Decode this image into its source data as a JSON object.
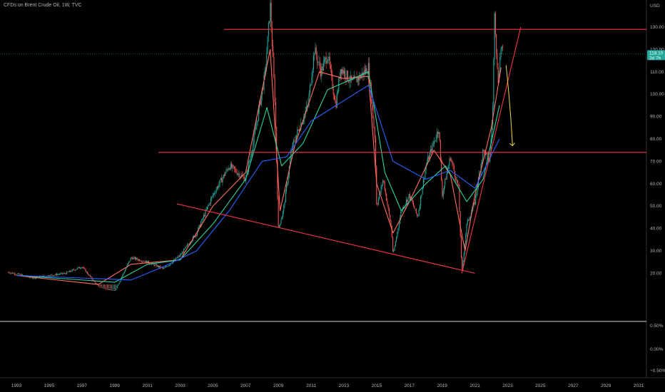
{
  "header": {
    "title": "CFDs on Brent Crude Oil, 1W, TVC",
    "currency": "USD"
  },
  "price_tag": {
    "value": "118.10",
    "countdown": "3d 7h",
    "color": "#26a69a"
  },
  "colors": {
    "background": "#000000",
    "resistance_lines": "#f23645",
    "arrow": "#f5d547",
    "ma_fast": "#ff6f61",
    "ma_mid": "#2bd4a4",
    "ma_slow": "#2962ff",
    "candle_up": "#26a69a",
    "candle_down": "#ef5350"
  },
  "chart_data": {
    "type": "candlestick",
    "symbol": "CFDs on Brent Crude Oil, 1W, TVC",
    "currency": "USD",
    "ylim": [
      20,
      145
    ],
    "y_ticks": [
      "130.00",
      "120.00",
      "110.00",
      "100.00",
      "90.00",
      "80.00",
      "70.00",
      "60.00",
      "50.00",
      "40.00",
      "30.00",
      "20.00"
    ],
    "x_ticks": [
      "1993",
      "1995",
      "1997",
      "1999",
      "2001",
      "2003",
      "2005",
      "2007",
      "2009",
      "2011",
      "2013",
      "2015",
      "2017",
      "2019",
      "2021",
      "2023",
      "2025",
      "2027",
      "2029",
      "2031"
    ],
    "indicator_ticks": [
      "0.50%",
      "0.00%",
      "−0.50%"
    ],
    "last_price": 118.1,
    "price_path": [
      {
        "x": 1992.5,
        "y": 20.5
      },
      {
        "x": 1994,
        "y": 18
      },
      {
        "x": 1996,
        "y": 20
      },
      {
        "x": 1997,
        "y": 23
      },
      {
        "x": 1998,
        "y": 14
      },
      {
        "x": 1999,
        "y": 12
      },
      {
        "x": 2000,
        "y": 27
      },
      {
        "x": 2001,
        "y": 25
      },
      {
        "x": 2002,
        "y": 22
      },
      {
        "x": 2003,
        "y": 28
      },
      {
        "x": 2004,
        "y": 38
      },
      {
        "x": 2005,
        "y": 55
      },
      {
        "x": 2006,
        "y": 68
      },
      {
        "x": 2007,
        "y": 62
      },
      {
        "x": 2007.5,
        "y": 80
      },
      {
        "x": 2008.2,
        "y": 110
      },
      {
        "x": 2008.5,
        "y": 140
      },
      {
        "x": 2008.8,
        "y": 95
      },
      {
        "x": 2009,
        "y": 40
      },
      {
        "x": 2009.3,
        "y": 48
      },
      {
        "x": 2009.8,
        "y": 75
      },
      {
        "x": 2010,
        "y": 80
      },
      {
        "x": 2010.8,
        "y": 95
      },
      {
        "x": 2011.2,
        "y": 120
      },
      {
        "x": 2011.6,
        "y": 110
      },
      {
        "x": 2012,
        "y": 118
      },
      {
        "x": 2012.5,
        "y": 95
      },
      {
        "x": 2012.8,
        "y": 112
      },
      {
        "x": 2013.5,
        "y": 105
      },
      {
        "x": 2014,
        "y": 108
      },
      {
        "x": 2014.5,
        "y": 112
      },
      {
        "x": 2014.9,
        "y": 80
      },
      {
        "x": 2015,
        "y": 50
      },
      {
        "x": 2015.4,
        "y": 62
      },
      {
        "x": 2015.9,
        "y": 40
      },
      {
        "x": 2016,
        "y": 28
      },
      {
        "x": 2016.5,
        "y": 48
      },
      {
        "x": 2017,
        "y": 55
      },
      {
        "x": 2017.5,
        "y": 45
      },
      {
        "x": 2018,
        "y": 68
      },
      {
        "x": 2018.8,
        "y": 85
      },
      {
        "x": 2019,
        "y": 55
      },
      {
        "x": 2019.5,
        "y": 72
      },
      {
        "x": 2020,
        "y": 58
      },
      {
        "x": 2020.2,
        "y": 20
      },
      {
        "x": 2020.5,
        "y": 42
      },
      {
        "x": 2021,
        "y": 52
      },
      {
        "x": 2021.5,
        "y": 75
      },
      {
        "x": 2021.9,
        "y": 70
      },
      {
        "x": 2022.1,
        "y": 95
      },
      {
        "x": 2022.2,
        "y": 139
      },
      {
        "x": 2022.4,
        "y": 105
      },
      {
        "x": 2022.6,
        "y": 122
      },
      {
        "x": 2022.7,
        "y": 118.1
      }
    ],
    "moving_averages": [
      {
        "name": "",
        "color": "#ff6f61",
        "y": [
          {
            "x": 1993,
            "y": 19
          },
          {
            "x": 1998,
            "y": 15
          },
          {
            "x": 2000,
            "y": 24
          },
          {
            "x": 2003,
            "y": 26
          },
          {
            "x": 2005,
            "y": 50
          },
          {
            "x": 2007,
            "y": 65
          },
          {
            "x": 2008.5,
            "y": 120
          },
          {
            "x": 2009.1,
            "y": 48
          },
          {
            "x": 2010,
            "y": 77
          },
          {
            "x": 2011.5,
            "y": 110
          },
          {
            "x": 2013,
            "y": 107
          },
          {
            "x": 2014.5,
            "y": 108
          },
          {
            "x": 2015,
            "y": 60
          },
          {
            "x": 2016,
            "y": 38
          },
          {
            "x": 2017,
            "y": 52
          },
          {
            "x": 2018.5,
            "y": 75
          },
          {
            "x": 2019.5,
            "y": 64
          },
          {
            "x": 2020.4,
            "y": 30
          },
          {
            "x": 2021,
            "y": 55
          },
          {
            "x": 2022,
            "y": 85
          },
          {
            "x": 2022.6,
            "y": 112
          }
        ]
      },
      {
        "name": "",
        "color": "#2bd4a4",
        "y": [
          {
            "x": 1993,
            "y": 19
          },
          {
            "x": 1999,
            "y": 16
          },
          {
            "x": 2001,
            "y": 24
          },
          {
            "x": 2003,
            "y": 26
          },
          {
            "x": 2005,
            "y": 42
          },
          {
            "x": 2007,
            "y": 62
          },
          {
            "x": 2008.3,
            "y": 94
          },
          {
            "x": 2009.2,
            "y": 68
          },
          {
            "x": 2010.5,
            "y": 78
          },
          {
            "x": 2012,
            "y": 102
          },
          {
            "x": 2014.5,
            "y": 110
          },
          {
            "x": 2015.5,
            "y": 65
          },
          {
            "x": 2016.5,
            "y": 48
          },
          {
            "x": 2018,
            "y": 60
          },
          {
            "x": 2019.2,
            "y": 68
          },
          {
            "x": 2020.5,
            "y": 52
          },
          {
            "x": 2021.5,
            "y": 62
          },
          {
            "x": 2022.5,
            "y": 95
          }
        ]
      },
      {
        "name": "",
        "color": "#2962ff",
        "y": [
          {
            "x": 1993,
            "y": 19
          },
          {
            "x": 2000,
            "y": 17
          },
          {
            "x": 2002,
            "y": 23
          },
          {
            "x": 2004,
            "y": 30
          },
          {
            "x": 2006,
            "y": 48
          },
          {
            "x": 2008,
            "y": 70
          },
          {
            "x": 2009.5,
            "y": 72
          },
          {
            "x": 2011,
            "y": 88
          },
          {
            "x": 2014.5,
            "y": 104
          },
          {
            "x": 2016,
            "y": 70
          },
          {
            "x": 2018,
            "y": 62
          },
          {
            "x": 2019.5,
            "y": 66
          },
          {
            "x": 2021,
            "y": 58
          },
          {
            "x": 2022.5,
            "y": 80
          }
        ]
      }
    ],
    "drawings": {
      "horizontal_lines": [
        129,
        74
      ],
      "trendlines": [
        {
          "from": {
            "x": 2002.8,
            "y": 51
          },
          "to": {
            "x": 2021,
            "y": 20
          }
        },
        {
          "from": {
            "x": 2020.2,
            "y": 20
          },
          "to": {
            "x": 2023.8,
            "y": 130
          }
        }
      ],
      "arrow": {
        "from": {
          "x": 2022.9,
          "y": 113
        },
        "to": {
          "x": 2023.3,
          "y": 77
        }
      }
    }
  }
}
